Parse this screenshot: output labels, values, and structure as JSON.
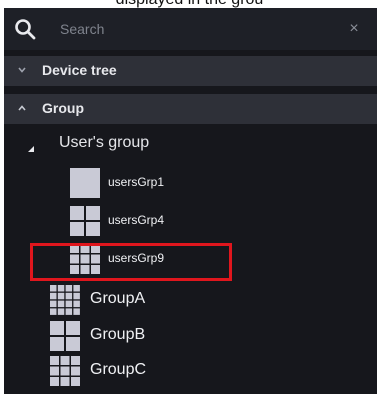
{
  "caption": "displayed in the grou",
  "search": {
    "placeholder": "Search"
  },
  "sections": {
    "device_tree": "Device tree",
    "group": "Group"
  },
  "tree": {
    "root_label": "User's group",
    "children": [
      {
        "label": "usersGrp1",
        "icon": "single-tile-icon"
      },
      {
        "label": "usersGrp4",
        "icon": "grid-2x2-icon"
      },
      {
        "label": "usersGrp9",
        "icon": "grid-3x3-icon",
        "highlighted": true
      }
    ],
    "groups": [
      {
        "label": "GroupA",
        "icon": "grid-4x4-icon"
      },
      {
        "label": "GroupB",
        "icon": "grid-2x2-icon"
      },
      {
        "label": "GroupC",
        "icon": "grid-3x3-icon"
      }
    ]
  },
  "colors": {
    "panel_bg": "#16171c",
    "header_bg": "#2e3038",
    "tile": "#c9cad6",
    "highlight": "#e0161d"
  }
}
